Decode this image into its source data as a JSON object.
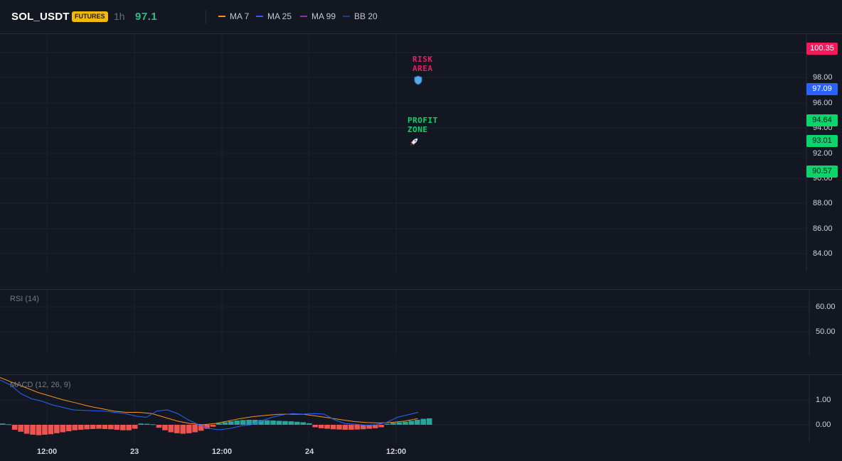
{
  "header": {
    "symbol": "SOL_USDT",
    "badge": "FUTURES",
    "timeframe": "1h",
    "price": "97.1",
    "legend": [
      {
        "label": "MA 7",
        "color": "#f7931a"
      },
      {
        "label": "MA 25",
        "color": "#2962ff"
      },
      {
        "label": "MA 99",
        "color": "#9c27b0"
      },
      {
        "label": "BB 20",
        "color": "#1e3a8a"
      }
    ]
  },
  "main_pane": {
    "y_ticks": [
      "98.00",
      "96.00",
      "94.00",
      "92.00",
      "90.00",
      "88.00",
      "86.00",
      "84.00"
    ],
    "price_tags": [
      {
        "value": "100.35",
        "bg": "#f7175b",
        "fg": "#ffffff"
      },
      {
        "value": "97.09",
        "bg": "#2962ff",
        "fg": "#ffffff"
      },
      {
        "value": "94.64",
        "bg": "#0bd46a",
        "fg": "#131722"
      },
      {
        "value": "93.01",
        "bg": "#0bd46a",
        "fg": "#131722"
      },
      {
        "value": "90.57",
        "bg": "#0bd46a",
        "fg": "#131722"
      }
    ],
    "annotations": {
      "risk_line1": "RISK",
      "risk_line2": "AREA",
      "risk_icon": "shield-icon",
      "profit_line1": "PROFIT",
      "profit_line2": "ZONE",
      "profit_icon": "rocket-icon"
    }
  },
  "rsi_pane": {
    "label": "RSI (14)",
    "y_ticks": [
      "60.00",
      "50.00"
    ]
  },
  "macd_pane": {
    "label": "MACD (12, 26, 9)",
    "y_ticks": [
      "1.00",
      "0.00"
    ]
  },
  "time_axis": [
    "12:00",
    "23",
    "12:00",
    "24",
    "12:00"
  ],
  "chart_data": {
    "type": "bar",
    "title": "MACD (12, 26, 9)",
    "ylim": [
      -0.5,
      1.8
    ],
    "histogram": [
      0.05,
      0.02,
      -0.2,
      -0.28,
      -0.36,
      -0.4,
      -0.42,
      -0.4,
      -0.38,
      -0.34,
      -0.3,
      -0.26,
      -0.22,
      -0.2,
      -0.18,
      -0.17,
      -0.16,
      -0.17,
      -0.18,
      -0.2,
      -0.22,
      -0.22,
      -0.16,
      0.05,
      0.04,
      0.02,
      -0.12,
      -0.22,
      -0.3,
      -0.34,
      -0.36,
      -0.34,
      -0.3,
      -0.24,
      -0.16,
      -0.08,
      0.06,
      0.1,
      0.14,
      0.17,
      0.19,
      0.2,
      0.2,
      0.19,
      0.18,
      0.17,
      0.16,
      0.15,
      0.14,
      0.12,
      0.1,
      0.06,
      -0.1,
      -0.14,
      -0.16,
      -0.18,
      -0.19,
      -0.2,
      -0.2,
      -0.19,
      -0.18,
      -0.16,
      -0.14,
      -0.1,
      0.04,
      0.08,
      0.1,
      0.12,
      0.16,
      0.2,
      0.24,
      0.26
    ],
    "macd_line": [
      1.8,
      1.6,
      1.25,
      1.05,
      0.95,
      0.8,
      0.7,
      0.6,
      0.58,
      0.56,
      0.55,
      0.5,
      0.45,
      0.35,
      0.3,
      0.55,
      0.6,
      0.45,
      0.2,
      0.0,
      -0.15,
      -0.2,
      -0.15,
      -0.05,
      0.0,
      0.15,
      0.3,
      0.4,
      0.45,
      0.43,
      0.45,
      0.43,
      0.2,
      0.05,
      0.02,
      -0.02,
      0.0,
      0.1,
      0.3,
      0.4,
      0.5
    ],
    "signal_line": [
      1.9,
      1.7,
      1.5,
      1.3,
      1.15,
      1.0,
      0.88,
      0.75,
      0.65,
      0.55,
      0.5,
      0.5,
      0.45,
      0.3,
      0.15,
      0.05,
      0.0,
      0.05,
      0.15,
      0.25,
      0.33,
      0.38,
      0.42,
      0.43,
      0.42,
      0.35,
      0.28,
      0.2,
      0.13,
      0.09,
      0.07,
      0.1,
      0.15,
      0.25
    ]
  }
}
